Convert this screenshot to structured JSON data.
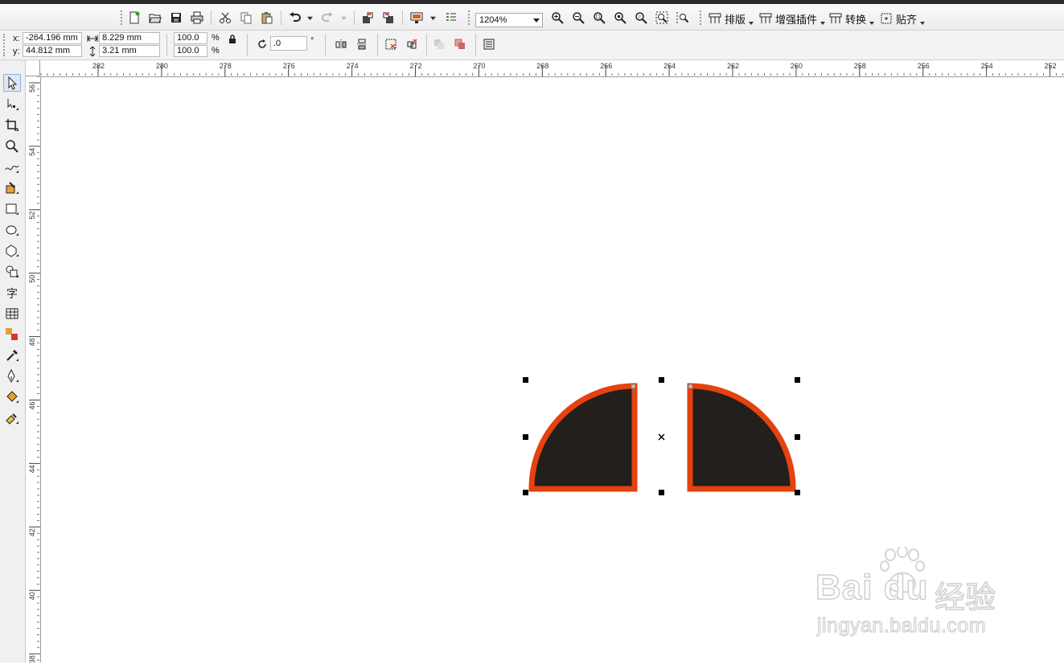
{
  "zoom": {
    "value": "1204%"
  },
  "menus": [
    {
      "label": "排版"
    },
    {
      "label": "增强插件"
    },
    {
      "label": "转换"
    },
    {
      "label": "贴齐"
    }
  ],
  "properties": {
    "x_label": "x:",
    "y_label": "y:",
    "x_value": "-264.196 mm",
    "y_value": "44.812 mm",
    "width_value": "8.229 mm",
    "height_value": "3.21 mm",
    "scale_x": "100.0",
    "scale_y": "100.0",
    "percent_x": "%",
    "percent_y": "%",
    "rotation_value": ".0",
    "degree_symbol": "°"
  },
  "hruler_ticks": [
    "282",
    "280",
    "278",
    "276",
    "274",
    "272",
    "270",
    "268",
    "266",
    "264",
    "262",
    "260",
    "258",
    "256",
    "254",
    "252"
  ],
  "vruler_ticks": [
    "56",
    "54",
    "52",
    "50",
    "48",
    "46",
    "44",
    "42",
    "40",
    "38"
  ],
  "shapes": {
    "fill_color": "#231f1c",
    "outline_color": "#e5420f"
  },
  "watermark": {
    "brand": "Bai du",
    "brand_cn": "经验",
    "url": "jingyan.baidu.com"
  }
}
